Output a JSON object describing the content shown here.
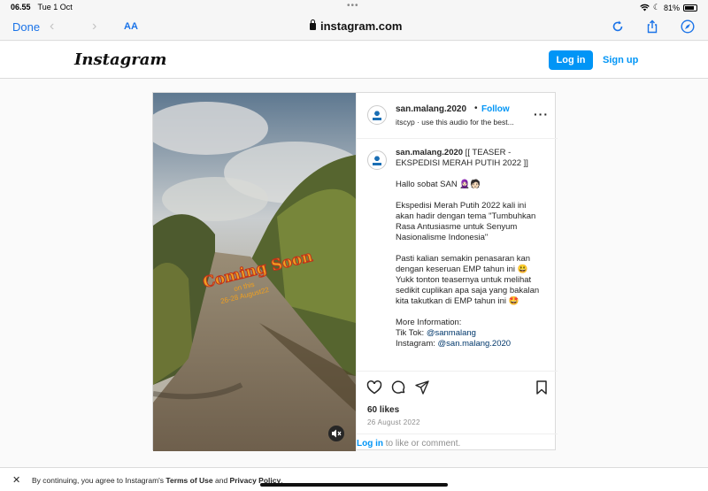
{
  "status_bar": {
    "time": "06.55",
    "date": "Tue 1 Oct",
    "battery": "81%"
  },
  "browser": {
    "done_label": "Done",
    "text_size_label": "AA",
    "url": "instagram.com"
  },
  "header": {
    "logo": "Instagram",
    "login_label": "Log in",
    "signup_label": "Sign up"
  },
  "media": {
    "overlay_title": "Coming Soon",
    "overlay_sub": "on this",
    "overlay_date": "26-28 August22"
  },
  "post": {
    "username": "san.malang.2020",
    "separator": "•",
    "follow_label": "Follow",
    "audio": "itscyp · use this audio for the best...",
    "caption_user": "san.malang.2020",
    "caption_first": " [[ TEASER - EKSPEDISI MERAH PUTIH 2022 ]]",
    "caption_p2": "Hallo sobat SAN 🧕🏻🧑🏻",
    "caption_p3": "Ekspedisi Merah Putih 2022 kali ini akan hadir dengan tema \"Tumbuhkan Rasa Antusiasme untuk Senyum Nasionalisme Indonesia\"",
    "caption_p4": "Pasti kalian semakin penasaran kan dengan keseruan EMP tahun ini 😃 Yukk tonton teasernya untuk melihat sedikit cuplikan apa saja yang bakalan kita takutkan di EMP tahun ini 🤩",
    "more_info": "More Information:",
    "tiktok_label": "Tik Tok: ",
    "tiktok_handle": "@sanmalang",
    "instagram_label": "Instagram: ",
    "instagram_handle": "@san.malang.2020",
    "likes": "60 likes",
    "date": "26 August 2022",
    "comment_login": "Log in",
    "comment_rest": " to like or comment."
  },
  "cookie": {
    "prefix": "By continuing, you agree to Instagram's ",
    "terms": "Terms of Use",
    "and": " and ",
    "privacy": "Privacy Policy",
    "suffix": "."
  },
  "colors": {
    "accent": "#0095f6",
    "safari_blue": "#1a73e8"
  }
}
